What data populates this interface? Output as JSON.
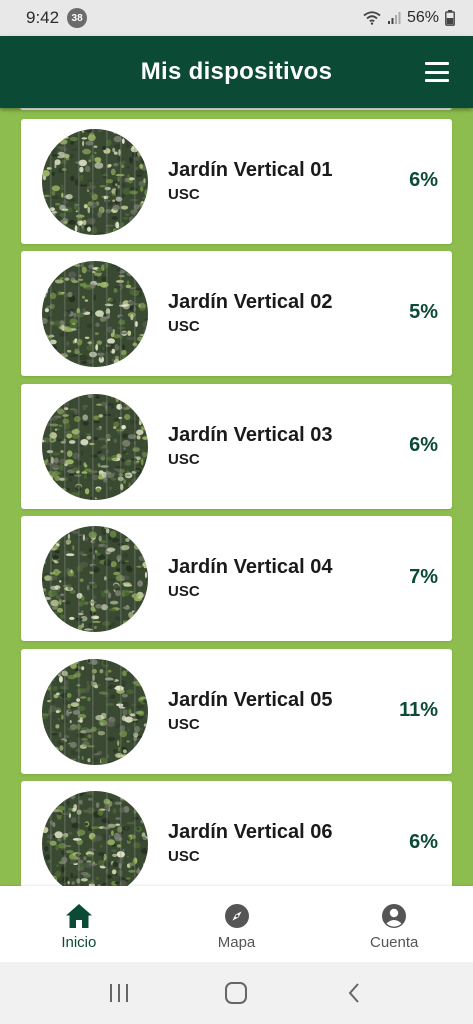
{
  "status_bar": {
    "time": "9:42",
    "notification_count": "38",
    "battery": "56%",
    "icons": [
      "wifi-icon",
      "signal-icon",
      "battery-icon"
    ]
  },
  "app_bar": {
    "title": "Mis dispositivos",
    "menu_icon": "menu-icon",
    "color": "#0b4a35"
  },
  "devices": [
    {
      "name": "Jardín Vertical 01",
      "org": "USC",
      "percent": "6%"
    },
    {
      "name": "Jardín Vertical 02",
      "org": "USC",
      "percent": "5%"
    },
    {
      "name": "Jardín Vertical 03",
      "org": "USC",
      "percent": "6%"
    },
    {
      "name": "Jardín Vertical 04",
      "org": "USC",
      "percent": "7%"
    },
    {
      "name": "Jardín Vertical 05",
      "org": "USC",
      "percent": "11%"
    },
    {
      "name": "Jardín Vertical 06",
      "org": "USC",
      "percent": "6%"
    }
  ],
  "bottom_nav": {
    "items": [
      {
        "label": "Inicio",
        "icon": "home-icon",
        "active": true
      },
      {
        "label": "Mapa",
        "icon": "compass-icon",
        "active": false
      },
      {
        "label": "Cuenta",
        "icon": "account-icon",
        "active": false
      }
    ]
  },
  "system_nav": {
    "icons": [
      "recents-icon",
      "home-circle-icon",
      "back-icon"
    ]
  },
  "colors": {
    "background": "#8dbd4e",
    "accent": "#0b4a35"
  }
}
